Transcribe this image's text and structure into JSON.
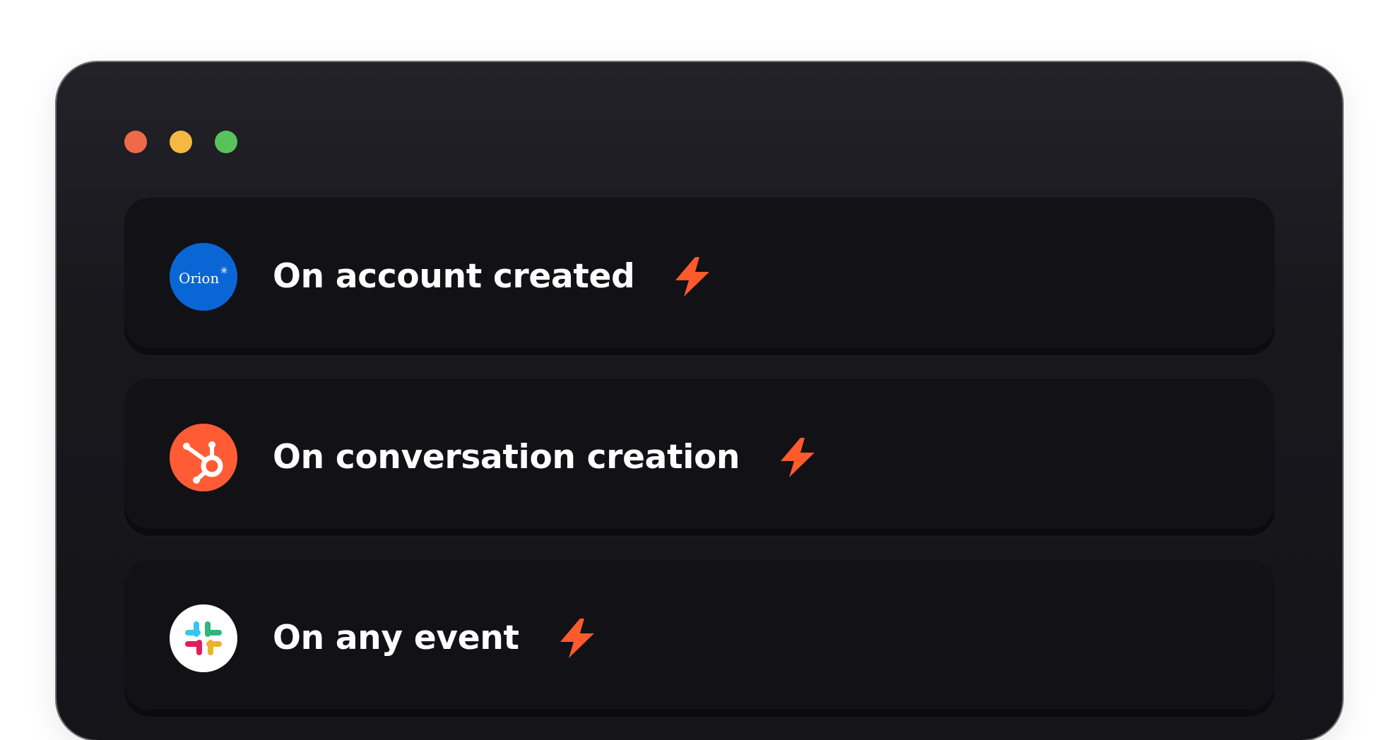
{
  "window": {
    "traffic_lights": [
      {
        "name": "close",
        "color": "#ee6a4a"
      },
      {
        "name": "minimize",
        "color": "#f5b842"
      },
      {
        "name": "maximize",
        "color": "#58c35a"
      }
    ]
  },
  "triggers": [
    {
      "label": "On account created",
      "logo": "orion-logo",
      "logo_text": "Orion",
      "logo_color": "#0a66d4"
    },
    {
      "label": "On conversation creation",
      "logo": "hubspot-logo",
      "logo_color": "#ff5c35"
    },
    {
      "label": "On any event",
      "logo": "slack-logo",
      "logo_color": "#ffffff"
    }
  ],
  "icons": {
    "trigger": "lightning-bolt-icon",
    "bolt_color": "#ff5a2c"
  }
}
